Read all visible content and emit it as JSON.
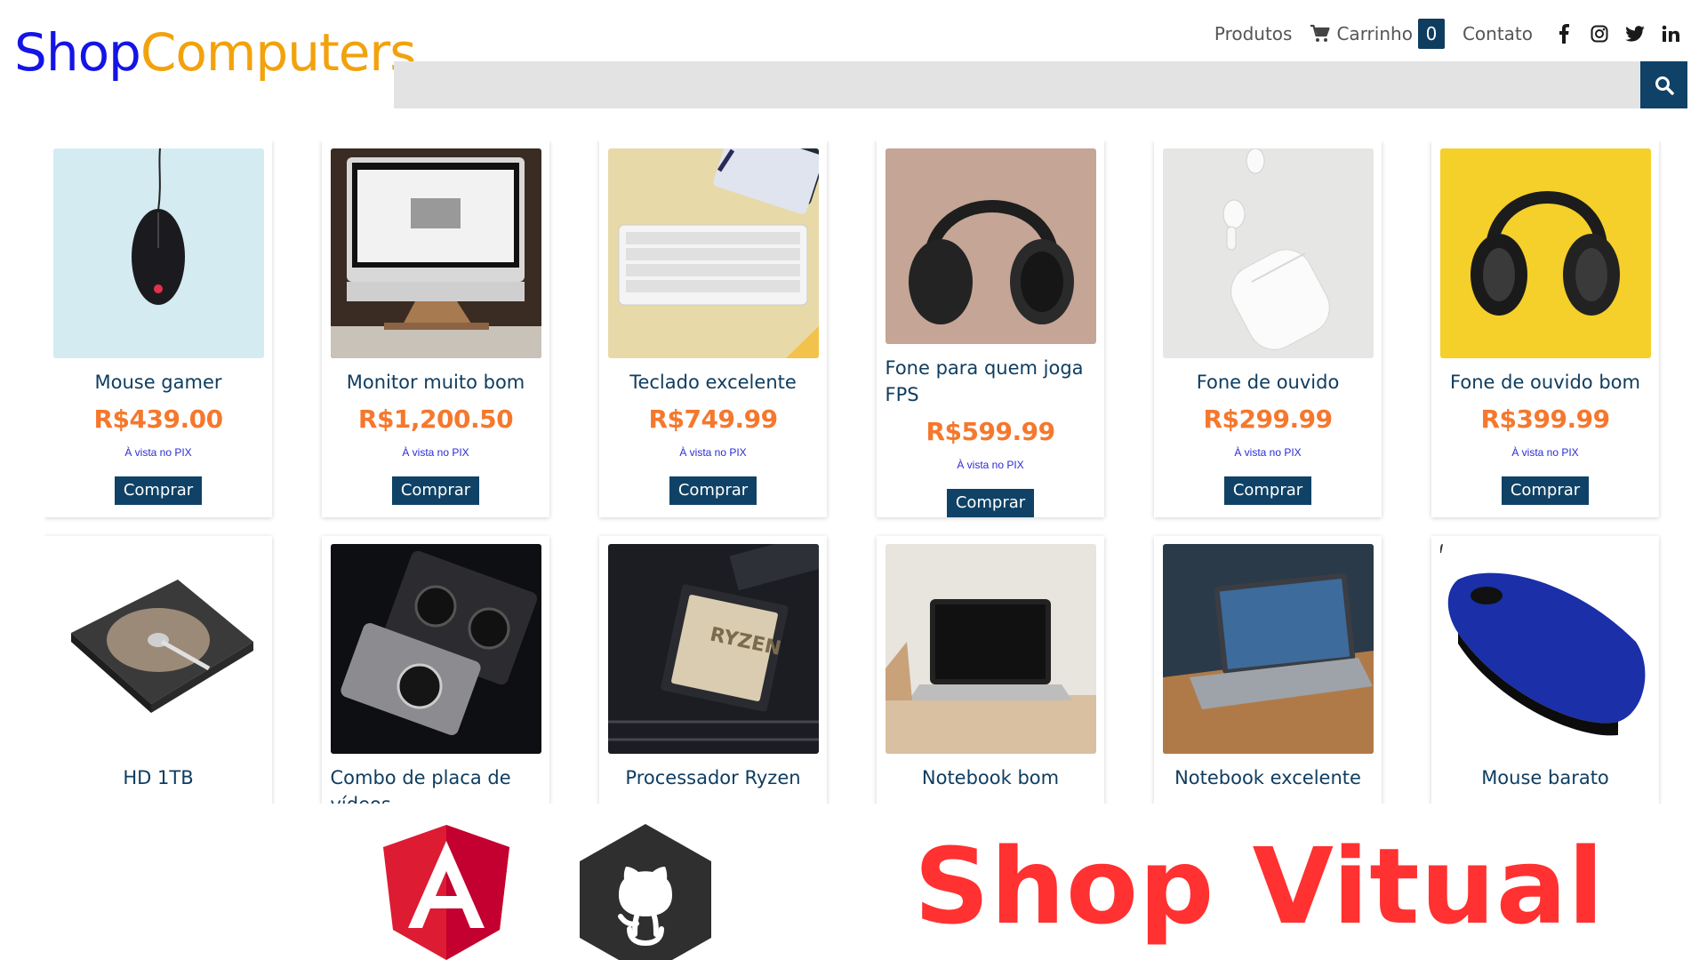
{
  "header": {
    "logo_part1": "Shop",
    "logo_part2": "Computers",
    "nav_products": "Produtos",
    "nav_cart": "Carrinho",
    "cart_count": "0",
    "nav_contact": "Contato",
    "social_icons": [
      "facebook-icon",
      "instagram-icon",
      "twitter-icon",
      "linkedin-icon"
    ]
  },
  "search": {
    "placeholder": "",
    "value": ""
  },
  "products": [
    {
      "name": "Mouse gamer",
      "price": "R$439.00",
      "pix": "À vista no PIX",
      "buy": "Comprar",
      "image": "gaming mouse on light blue"
    },
    {
      "name": "Monitor muito bom",
      "price": "R$1,200.50",
      "pix": "À vista no PIX",
      "buy": "Comprar",
      "image": "desktop monitor on stand"
    },
    {
      "name": "Teclado excelente",
      "price": "R$749.99",
      "pix": "À vista no PIX",
      "buy": "Comprar",
      "image": "white keyboard on beige"
    },
    {
      "name": "Fone para quem joga FPS",
      "price": "R$599.99",
      "pix": "À vista no PIX",
      "buy": "Comprar",
      "image": "black headphones on pink"
    },
    {
      "name": "Fone de ouvido",
      "price": "R$299.99",
      "pix": "À vista no PIX",
      "buy": "Comprar",
      "image": "white earbuds with case"
    },
    {
      "name": "Fone de ouvido bom",
      "price": "R$399.99",
      "pix": "À vista no PIX",
      "buy": "Comprar",
      "image": "headphones on yellow"
    },
    {
      "name": "HD 1TB",
      "image": "open hard drive"
    },
    {
      "name": "Combo de placa de vídeos",
      "image": "graphics cards on dark"
    },
    {
      "name": "Processador Ryzen",
      "image": "ryzen processor on motherboard"
    },
    {
      "name": "Notebook bom",
      "image": "laptop on wooden desk"
    },
    {
      "name": "Notebook excelente",
      "image": "laptop on table"
    },
    {
      "name": "Mouse barato",
      "image": "blue mouse"
    }
  ],
  "footer": {
    "angular_letter": "A",
    "banner": "Shop Vitual"
  },
  "colors": {
    "brand_blue": "#1414e6",
    "brand_orange": "#f2a20c",
    "primary_dark": "#0f4266",
    "price_orange": "#f5782d",
    "banner_red": "#ff3131"
  }
}
